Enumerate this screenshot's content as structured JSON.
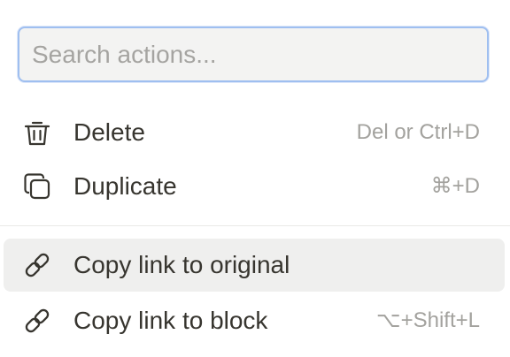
{
  "search": {
    "placeholder": "Search actions...",
    "value": ""
  },
  "items": [
    {
      "label": "Delete",
      "shortcut": "Del or Ctrl+D",
      "icon": "trash-icon"
    },
    {
      "label": "Duplicate",
      "shortcut": "⌘+D",
      "icon": "duplicate-icon"
    },
    {
      "label": "Copy link to original",
      "shortcut": "",
      "icon": "link-icon"
    },
    {
      "label": "Copy link to block",
      "shortcut": "⌥+Shift+L",
      "icon": "link-icon"
    }
  ],
  "colors": {
    "text": "#37352f",
    "muted": "#a3a29e",
    "hover_bg": "#efefee",
    "search_border": "#9fbff0"
  }
}
